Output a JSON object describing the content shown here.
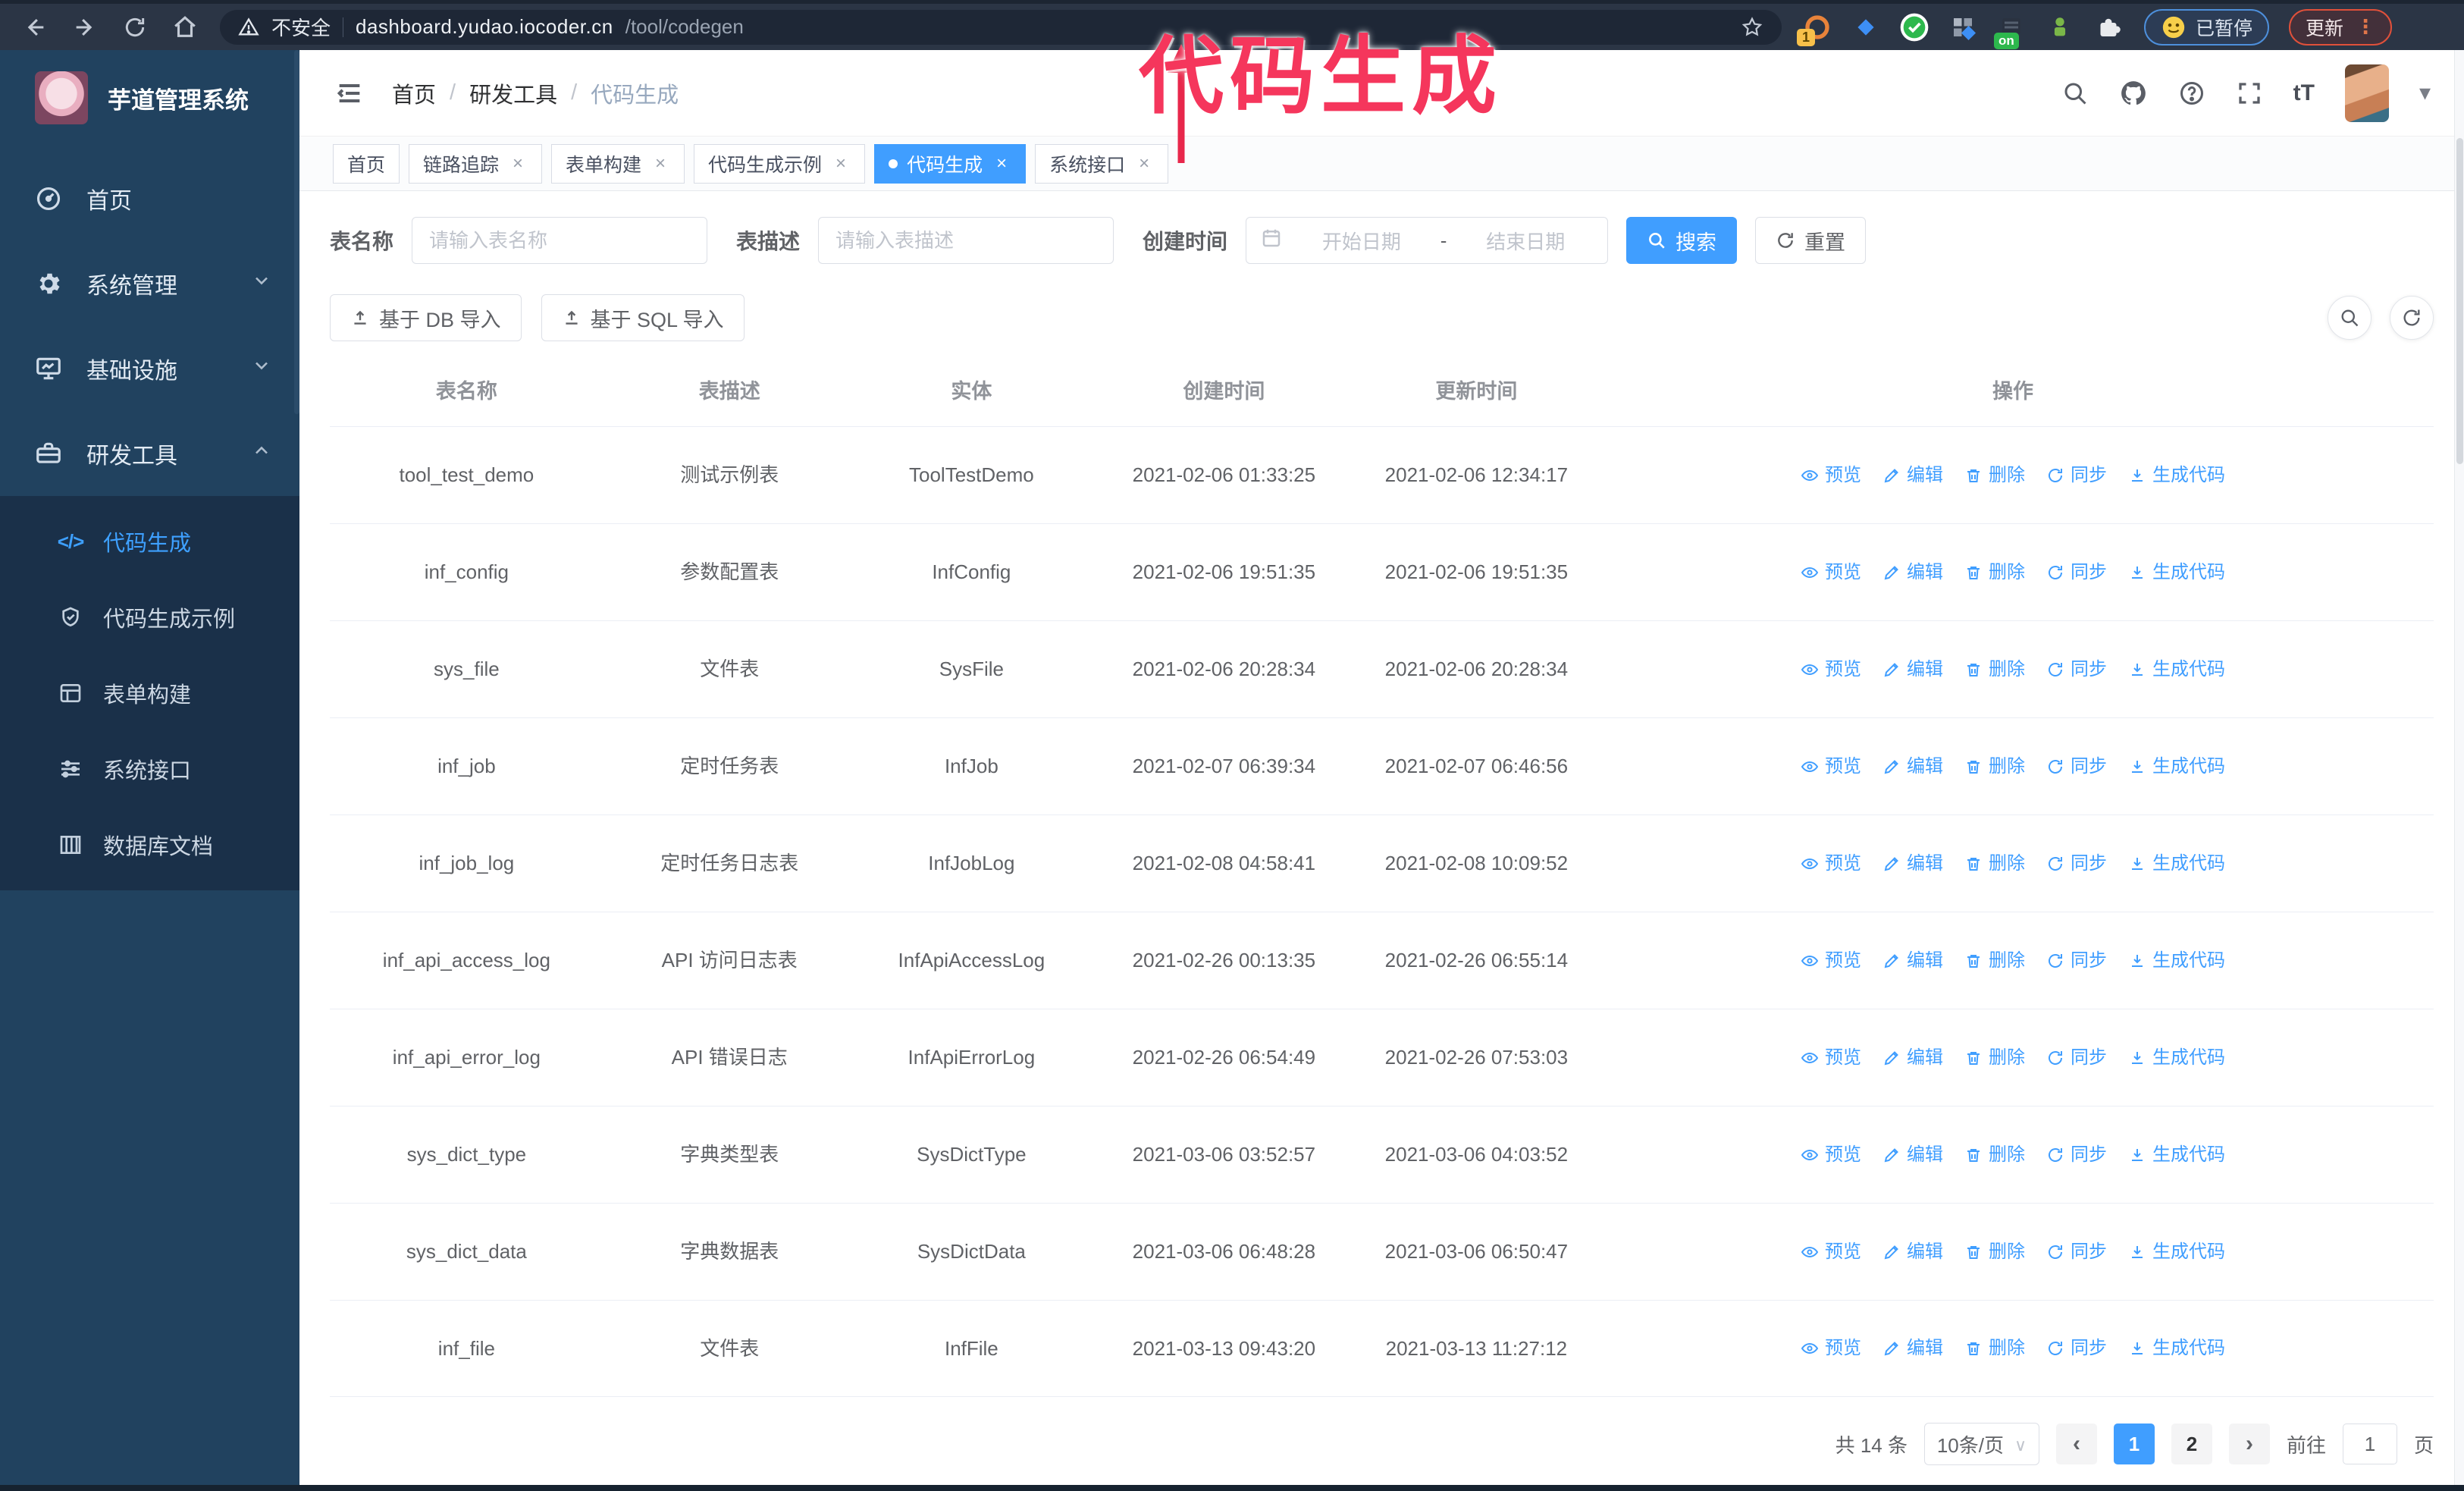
{
  "colors": {
    "accent": "#409eff",
    "annotation": "#f5365c",
    "sidebar_bg": "#21425f",
    "submenu_bg": "#1a3049",
    "chrome_bg": "#2b3545",
    "update_button_border": "#e0503a",
    "paused_badge_border": "#4d8fdb"
  },
  "browser": {
    "security_label": "不安全",
    "url_host": "dashboard.yudao.iocoder.cn",
    "url_path": "/tool/codegen",
    "extension_badge": "1",
    "extension_on_label": "on",
    "paused_badge": "已暂停",
    "update_label": "更新"
  },
  "annotation": {
    "text": "代码生成"
  },
  "sidebar": {
    "logo_title": "芋道管理系统",
    "items": [
      {
        "label": "首页"
      },
      {
        "label": "系统管理"
      },
      {
        "label": "基础设施"
      },
      {
        "label": "研发工具"
      }
    ],
    "submenu": [
      {
        "label": "代码生成"
      },
      {
        "label": "代码生成示例"
      },
      {
        "label": "表单构建"
      },
      {
        "label": "系统接口"
      },
      {
        "label": "数据库文档"
      }
    ]
  },
  "header": {
    "breadcrumb": {
      "home": "首页",
      "section": "研发工具",
      "current": "代码生成"
    }
  },
  "tabs": [
    {
      "label": "首页"
    },
    {
      "label": "链路追踪"
    },
    {
      "label": "表单构建"
    },
    {
      "label": "代码生成示例"
    },
    {
      "label": "代码生成"
    },
    {
      "label": "系统接口"
    }
  ],
  "filters": {
    "name_label": "表名称",
    "name_placeholder": "请输入表名称",
    "desc_label": "表描述",
    "desc_placeholder": "请输入表描述",
    "time_label": "创建时间",
    "start_placeholder": "开始日期",
    "range_separator": "-",
    "end_placeholder": "结束日期",
    "search_label": "搜索",
    "reset_label": "重置"
  },
  "toolbar": {
    "import_db_label": "基于 DB 导入",
    "import_sql_label": "基于 SQL 导入"
  },
  "table": {
    "columns": [
      "表名称",
      "表描述",
      "实体",
      "创建时间",
      "更新时间",
      "操作"
    ],
    "actions": [
      "预览",
      "编辑",
      "删除",
      "同步",
      "生成代码"
    ],
    "rows": [
      {
        "name": "tool_test_demo",
        "desc": "测试示例表",
        "entity": "ToolTestDemo",
        "created": "2021-02-06 01:33:25",
        "updated": "2021-02-06 12:34:17"
      },
      {
        "name": "inf_config",
        "desc": "参数配置表",
        "entity": "InfConfig",
        "created": "2021-02-06 19:51:35",
        "updated": "2021-02-06 19:51:35"
      },
      {
        "name": "sys_file",
        "desc": "文件表",
        "entity": "SysFile",
        "created": "2021-02-06 20:28:34",
        "updated": "2021-02-06 20:28:34"
      },
      {
        "name": "inf_job",
        "desc": "定时任务表",
        "entity": "InfJob",
        "created": "2021-02-07 06:39:34",
        "updated": "2021-02-07 06:46:56"
      },
      {
        "name": "inf_job_log",
        "desc": "定时任务日志表",
        "entity": "InfJobLog",
        "created": "2021-02-08 04:58:41",
        "updated": "2021-02-08 10:09:52"
      },
      {
        "name": "inf_api_access_log",
        "desc": "API 访问日志表",
        "entity": "InfApiAccessLog",
        "created": "2021-02-26 00:13:35",
        "updated": "2021-02-26 06:55:14"
      },
      {
        "name": "inf_api_error_log",
        "desc": "API 错误日志",
        "entity": "InfApiErrorLog",
        "created": "2021-02-26 06:54:49",
        "updated": "2021-02-26 07:53:03"
      },
      {
        "name": "sys_dict_type",
        "desc": "字典类型表",
        "entity": "SysDictType",
        "created": "2021-03-06 03:52:57",
        "updated": "2021-03-06 04:03:52"
      },
      {
        "name": "sys_dict_data",
        "desc": "字典数据表",
        "entity": "SysDictData",
        "created": "2021-03-06 06:48:28",
        "updated": "2021-03-06 06:50:47"
      },
      {
        "name": "inf_file",
        "desc": "文件表",
        "entity": "InfFile",
        "created": "2021-03-13 09:43:20",
        "updated": "2021-03-13 11:27:12"
      }
    ]
  },
  "pagination": {
    "total_label": "共 14 条",
    "page_size_label": "10条/页",
    "pages": [
      "1",
      "2"
    ],
    "active_page": "1",
    "goto_label": "前往",
    "goto_value": "1",
    "goto_suffix": "页"
  }
}
